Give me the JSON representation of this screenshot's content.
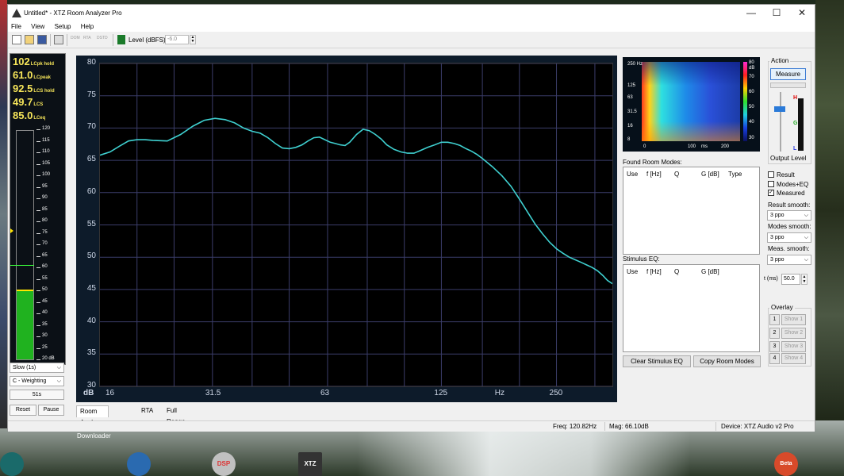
{
  "window": {
    "title": "Untitled* - XTZ Room Analyzer Pro"
  },
  "menu": [
    "File",
    "View",
    "Setup",
    "Help"
  ],
  "toolbar": {
    "level_label": "Level (dBFS)",
    "level_value": "-6.0",
    "gray_buttons": [
      "DOM",
      "RTA",
      "DSTD"
    ]
  },
  "meter": {
    "readings": [
      {
        "value": "102",
        "label": "LCpk hold"
      },
      {
        "value": "61.0",
        "label": "LCpeak"
      },
      {
        "value": "92.5",
        "label": "LCS hold"
      },
      {
        "value": "49.7",
        "label": "LCS"
      },
      {
        "value": "85.0",
        "label": "LCeq"
      }
    ],
    "scale": [
      "120",
      "115",
      "110",
      "105",
      "100",
      "95",
      "90",
      "85",
      "80",
      "75",
      "70",
      "65",
      "60",
      "55",
      "50",
      "45",
      "40",
      "35",
      "30",
      "25",
      "20 dB"
    ],
    "level_db": 49.7,
    "peak_db": 61.0,
    "speed": "Slow (1s)",
    "weighting": "C - Weighting",
    "elapsed": "51s",
    "reset_label": "Reset",
    "pause_label": "Pause"
  },
  "chart_data": {
    "type": "line",
    "x_scale": "log",
    "xlim": [
      16,
      350
    ],
    "ylim": [
      30,
      80
    ],
    "xticks": [
      "16",
      "31.5",
      "63",
      "125",
      "Hz",
      "250"
    ],
    "yticks": [
      "80",
      "75",
      "70",
      "65",
      "60",
      "55",
      "50",
      "45",
      "40",
      "35",
      "30"
    ],
    "y_unit": "dB",
    "grid": true,
    "series": [
      {
        "color": "#3fd0d0",
        "x": [
          16,
          17,
          18,
          19,
          20,
          21,
          22,
          24,
          26,
          28,
          30,
          32,
          34,
          36,
          38,
          40,
          42,
          44,
          46,
          48,
          50,
          52,
          54,
          56,
          58,
          60,
          62,
          64,
          66,
          68,
          70,
          72,
          75,
          78,
          81,
          84,
          87,
          90,
          94,
          98,
          102,
          106,
          110,
          115,
          120,
          125,
          130,
          135,
          140,
          145,
          150,
          155,
          160,
          170,
          180,
          190,
          200,
          210,
          220,
          230,
          240,
          250,
          260,
          270,
          280,
          290,
          300,
          310,
          320,
          330,
          340,
          350
        ],
        "y": [
          65.8,
          66.3,
          67.2,
          68.0,
          68.2,
          68.2,
          68.1,
          68.0,
          69.0,
          70.3,
          71.2,
          71.5,
          71.3,
          70.8,
          70.0,
          69.5,
          69.2,
          68.5,
          67.6,
          66.9,
          66.8,
          67.0,
          67.4,
          68.0,
          68.5,
          68.6,
          68.2,
          67.8,
          67.6,
          67.4,
          67.3,
          67.8,
          69.0,
          69.8,
          69.6,
          69.0,
          68.3,
          67.4,
          66.7,
          66.3,
          66.1,
          66.1,
          66.5,
          67.0,
          67.4,
          67.8,
          67.8,
          67.6,
          67.3,
          66.8,
          66.4,
          65.9,
          65.3,
          64.0,
          62.6,
          61.0,
          59.0,
          57.0,
          55.1,
          53.6,
          52.3,
          51.3,
          50.6,
          50.0,
          49.6,
          49.2,
          48.8,
          48.4,
          47.9,
          47.2,
          46.4,
          45.9
        ]
      }
    ]
  },
  "tabs": [
    "Room Analyzer",
    "RTA",
    "Full Range"
  ],
  "spectrogram": {
    "y_labels": [
      "250\nHz",
      "125",
      "63",
      "31.5",
      "16",
      "8"
    ],
    "y_units": [
      "Hz"
    ],
    "x_labels": [
      "0",
      "100",
      "ms",
      "200"
    ],
    "cbar_labels": [
      "80",
      "dB",
      "70",
      "60",
      "50",
      "40",
      "30"
    ]
  },
  "found_modes": {
    "title": "Found Room Modes:",
    "columns": [
      "Use",
      "f [Hz]",
      "Q",
      "G [dB]",
      "Type"
    ]
  },
  "stimulus_eq": {
    "title": "Stimulus EQ:",
    "columns": [
      "Use",
      "f [Hz]",
      "Q",
      "G [dB]"
    ]
  },
  "buttons": {
    "clear_eq": "Clear Stimulus EQ",
    "copy_modes": "Copy Room Modes"
  },
  "action": {
    "title": "Action",
    "measure": "Measure",
    "output_level_label": "Output Level",
    "meter_marks": [
      "H",
      "G",
      "L"
    ]
  },
  "display": {
    "checkboxes": [
      {
        "label": "Result",
        "checked": false
      },
      {
        "label": "Modes+EQ",
        "checked": false
      },
      {
        "label": "Measured",
        "checked": true
      }
    ],
    "result_smooth_label": "Result smooth:",
    "result_smooth": "3 ppo",
    "modes_smooth_label": "Modes smooth:",
    "modes_smooth": "3 ppo",
    "meas_smooth_label": "Meas. smooth:",
    "meas_smooth": "3 ppo",
    "t_label": "t (ms)",
    "t_value": "50.0"
  },
  "overlay": {
    "title": "Overlay",
    "items": [
      {
        "num": "1",
        "label": "Show 1"
      },
      {
        "num": "2",
        "label": "Show 2"
      },
      {
        "num": "3",
        "label": "Show 3"
      },
      {
        "num": "4",
        "label": "Show 4"
      }
    ]
  },
  "status": {
    "freq": "Freq: 120.82Hz",
    "mag": "Mag: 66.10dB",
    "device": "Device: XTZ Audio v2 Pro"
  },
  "desktop": {
    "downloader_label": "Downloader",
    "icons": [
      "DSP",
      "XTZ",
      "Beta"
    ]
  }
}
